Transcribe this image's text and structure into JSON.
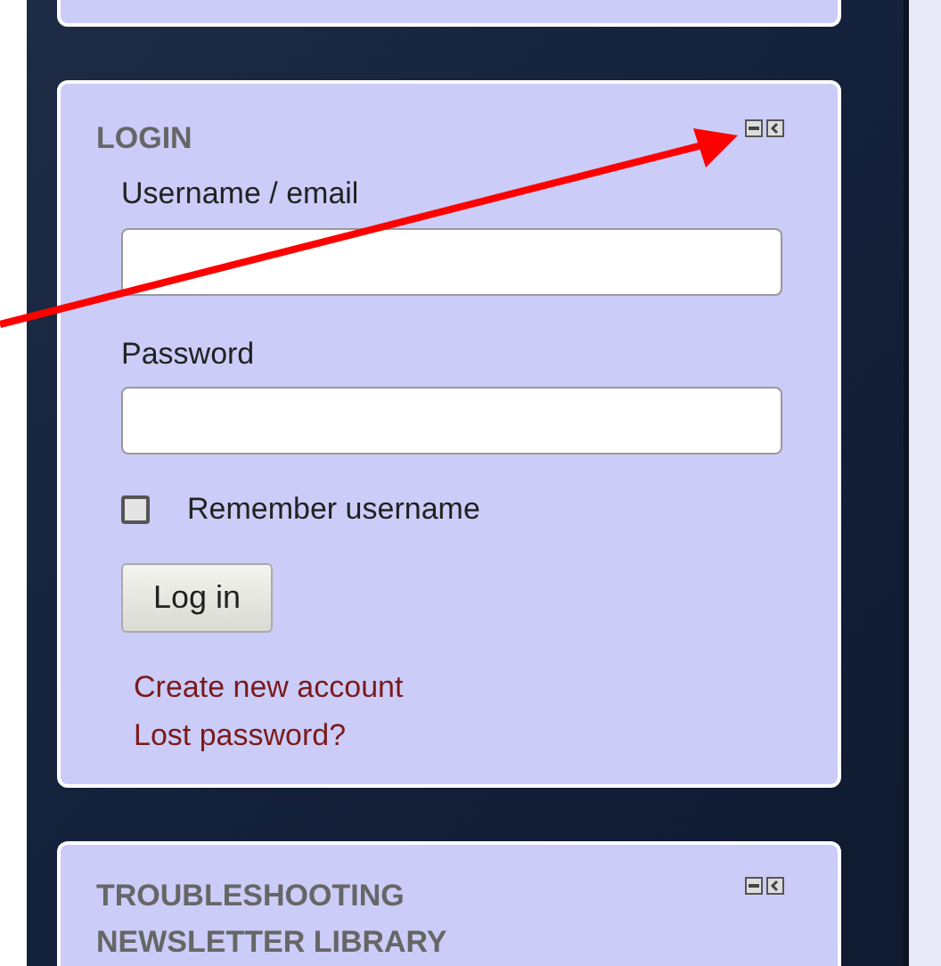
{
  "login_block": {
    "title": "LOGIN",
    "fields": [
      {
        "label": "Username / email"
      },
      {
        "label": "Password"
      }
    ],
    "remember": {
      "label": "Remember username",
      "checked": false
    },
    "button": "Log in",
    "links": [
      "Create new account",
      "Lost password?"
    ]
  },
  "next_block": {
    "title": "TROUBLESHOOTING NEWSLETTER LIBRARY"
  }
}
